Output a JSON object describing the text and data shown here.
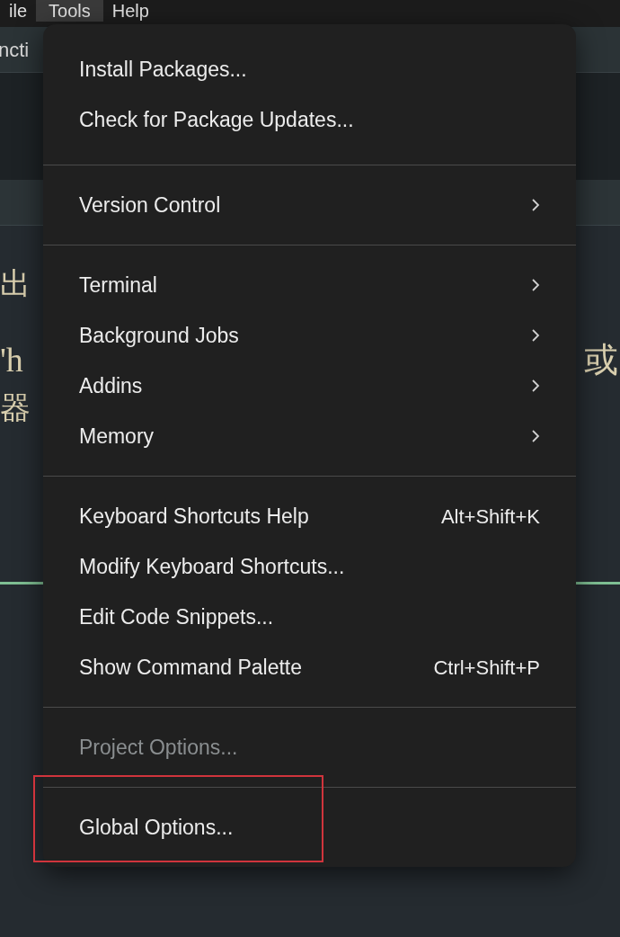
{
  "menubar": [
    {
      "label": "ile",
      "selected": false
    },
    {
      "label": "Tools",
      "selected": true
    },
    {
      "label": "Help",
      "selected": false
    }
  ],
  "tab": {
    "label": "ncti"
  },
  "editor": {
    "lines": [
      {
        "left": "出"
      },
      {
        "left": "'h",
        "right": "或"
      },
      {
        "left": "器"
      }
    ]
  },
  "menu": {
    "groups": [
      {
        "items": [
          {
            "label": "Install Packages...",
            "submenu": false,
            "disabled": false,
            "highlighted": false
          },
          {
            "label": "Check for Package Updates...",
            "submenu": false,
            "disabled": false,
            "highlighted": false
          }
        ]
      },
      {
        "items": [
          {
            "label": "Version Control",
            "submenu": true,
            "disabled": false,
            "highlighted": false
          }
        ]
      },
      {
        "items": [
          {
            "label": "Terminal",
            "submenu": true,
            "disabled": false,
            "highlighted": false
          },
          {
            "label": "Background Jobs",
            "submenu": true,
            "disabled": false,
            "highlighted": false
          },
          {
            "label": "Addins",
            "submenu": true,
            "disabled": false,
            "highlighted": false
          },
          {
            "label": "Memory",
            "submenu": true,
            "disabled": false,
            "highlighted": false
          }
        ]
      },
      {
        "items": [
          {
            "label": "Keyboard Shortcuts Help",
            "shortcut": "Alt+Shift+K",
            "submenu": false,
            "disabled": false,
            "highlighted": false
          },
          {
            "label": "Modify Keyboard Shortcuts...",
            "submenu": false,
            "disabled": false,
            "highlighted": false
          },
          {
            "label": "Edit Code Snippets...",
            "submenu": false,
            "disabled": false,
            "highlighted": false
          },
          {
            "label": "Show Command Palette",
            "shortcut": "Ctrl+Shift+P",
            "submenu": false,
            "disabled": false,
            "highlighted": false
          }
        ]
      },
      {
        "items": [
          {
            "label": "Project Options...",
            "submenu": false,
            "disabled": true,
            "highlighted": false
          }
        ]
      },
      {
        "items": [
          {
            "label": "Global Options...",
            "submenu": false,
            "disabled": false,
            "highlighted": true
          }
        ]
      }
    ]
  }
}
